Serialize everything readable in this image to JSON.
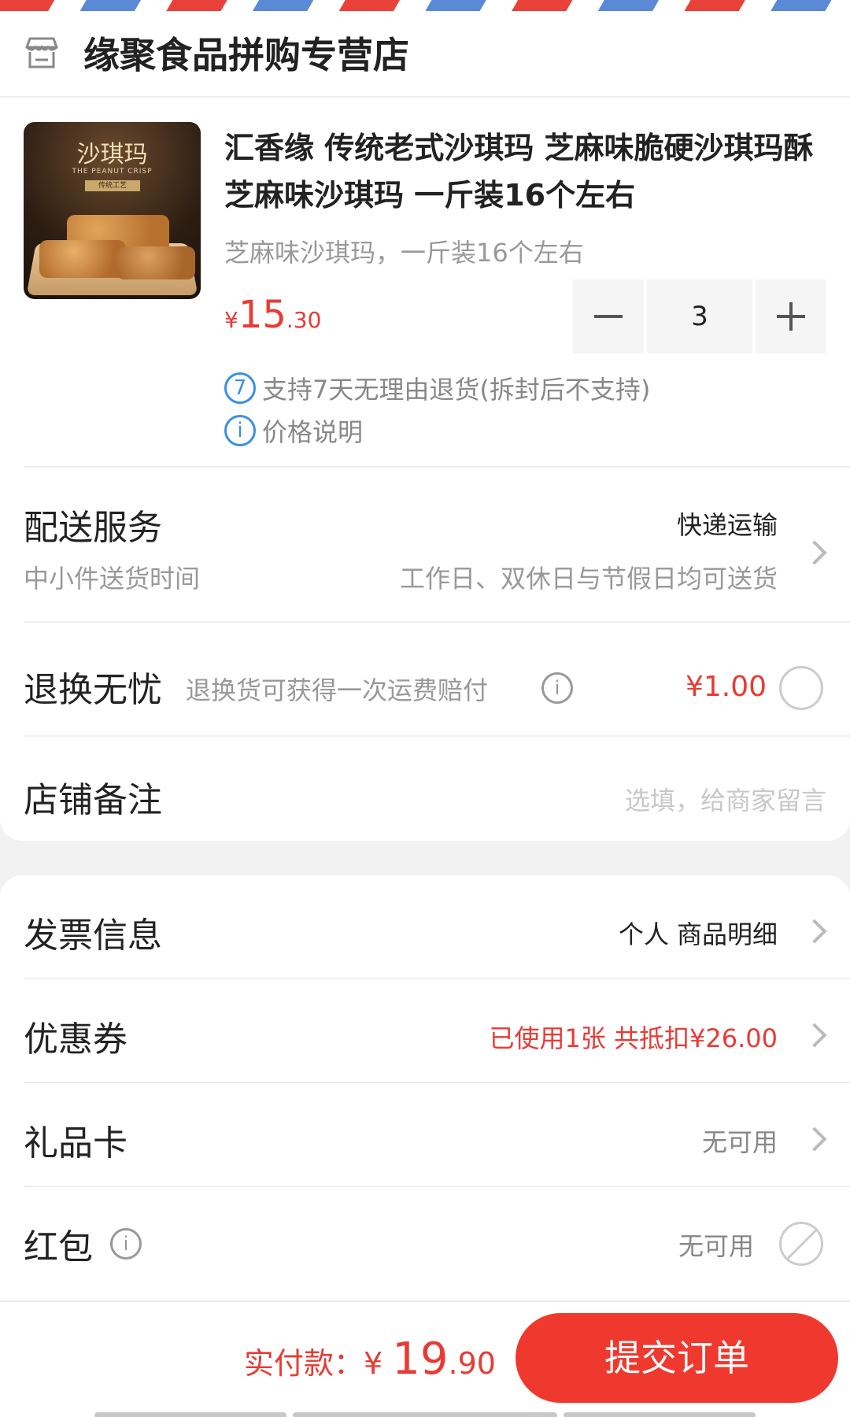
{
  "shop": {
    "name": "缘聚食品拼购专营店",
    "icon": "store-icon"
  },
  "product": {
    "thumb_text": "沙琪玛",
    "thumb_sub": "THE PEANUT CRISP",
    "thumb_tag": "传统工艺",
    "title": "汇香缘 传统老式沙琪玛 芝麻味脆硬沙琪玛酥 芝麻味沙琪玛 一斤装16个左右",
    "spec": "芝麻味沙琪玛，一斤装16个左右",
    "price_symbol": "¥",
    "price_int": "15",
    "price_dec": ".30",
    "quantity": "3",
    "return_badge": "7",
    "return_policy": "支持7天无理由退货(拆封后不支持)",
    "price_info_icon": "i",
    "price_info": "价格说明"
  },
  "delivery": {
    "title": "配送服务",
    "method": "快递运输",
    "sub_label": "中小件送货时间",
    "sub_value": "工作日、双休日与节假日均可送货"
  },
  "return_insurance": {
    "title": "退换无忧",
    "desc": "退换货可获得一次运费赔付",
    "info_icon": "i",
    "price": "¥1.00"
  },
  "store_note": {
    "title": "店铺备注",
    "placeholder": "选填，给商家留言"
  },
  "invoice": {
    "title": "发票信息",
    "value": "个人 商品明细"
  },
  "coupon": {
    "title": "优惠券",
    "value": "已使用1张 共抵扣¥26.00"
  },
  "gift_card": {
    "title": "礼品卡",
    "value": "无可用"
  },
  "red_packet": {
    "title": "红包",
    "info_icon": "i",
    "value": "无可用"
  },
  "footer": {
    "pay_label": "实付款：",
    "pay_symbol": "¥ ",
    "pay_int": "19",
    "pay_dec": ".90",
    "submit_label": "提交订单"
  },
  "colors": {
    "accent_red": "#e83b35",
    "button_red": "#f0392e",
    "info_blue": "#3a8ee6"
  }
}
